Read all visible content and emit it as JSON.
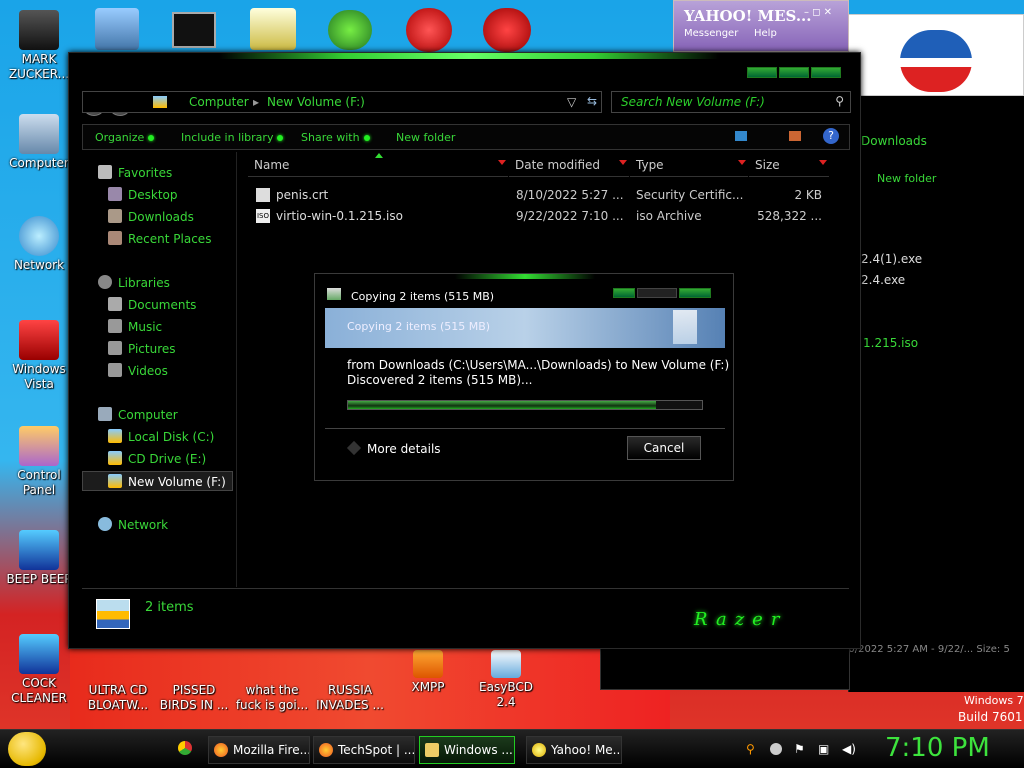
{
  "desktop_icons": [
    {
      "label": "MARK ZUCKER...",
      "icon": "person-icon"
    },
    {
      "label": "Computer",
      "icon": "computer-icon"
    },
    {
      "label": "Network",
      "icon": "network-icon"
    },
    {
      "label": "Windows Vista",
      "icon": "recycle-bin-icon"
    },
    {
      "label": "Control Panel",
      "icon": "control-panel-icon"
    },
    {
      "label": "BEEP BEEP",
      "icon": "file-icon"
    },
    {
      "label": "COCK CLEANER",
      "icon": "file-icon"
    },
    {
      "label": "ULTRA CD BLOATW...",
      "icon": "cd-icon"
    },
    {
      "label": "PISSED BIRDS IN ...",
      "icon": "bird-icon"
    },
    {
      "label": "what the fuck is goi...",
      "icon": "pig-icon"
    },
    {
      "label": "RUSSIA INVADES ...",
      "icon": "file-icon"
    },
    {
      "label": "XMPP",
      "icon": "xmpp-icon"
    },
    {
      "label": "EasyBCD 2.4",
      "icon": "easybcd-icon"
    }
  ],
  "yahoo": {
    "title": "YAHOO! MES...",
    "menu1": "Messenger",
    "menu2": "Help"
  },
  "explorer": {
    "breadcrumb": [
      "Computer",
      "New Volume (F:)"
    ],
    "search_placeholder": "Search New Volume (F:)",
    "toolbar": [
      "Organize",
      "Include in library",
      "Share with",
      "New folder"
    ],
    "nav": {
      "favorites": "Favorites",
      "favorites_items": [
        "Desktop",
        "Downloads",
        "Recent Places"
      ],
      "libraries": "Libraries",
      "libraries_items": [
        "Documents",
        "Music",
        "Pictures",
        "Videos"
      ],
      "computer": "Computer",
      "computer_items": [
        "Local Disk (C:)",
        "CD Drive (E:)",
        "New Volume (F:)"
      ],
      "network": "Network"
    },
    "columns": [
      "Name",
      "Date modified",
      "Type",
      "Size"
    ],
    "files": [
      {
        "name": "penis.crt",
        "date": "8/10/2022 5:27 ...",
        "type": "Security Certific...",
        "size": "2 KB"
      },
      {
        "name": "virtio-win-0.1.215.iso",
        "date": "9/22/2022 7:10 ...",
        "type": "iso Archive",
        "size": "528,322 ..."
      }
    ],
    "status": "2 items",
    "brand": "Razer"
  },
  "copy_dialog": {
    "title": "Copying 2 items (515 MB)",
    "header": "Copying 2 items (515 MB)",
    "from_line": "from Downloads (C:\\Users\\MA...\\Downloads) to New Volume (F:)",
    "discovered": "Discovered 2 items (515 MB)...",
    "progress": 0.87,
    "more_details": "More details",
    "cancel": "Cancel"
  },
  "bg_window": {
    "path_tail": "Downloads",
    "new_folder": "New folder",
    "items": [
      "2.4(1).exe",
      "2.4.exe",
      "1.215.iso"
    ],
    "status": "2 items selected  Date modified: 8/10/2022 5:27 AM - 9/22/...  Size: 5"
  },
  "watermark": {
    "line1": "Windows 7",
    "line2": "Build 7601"
  },
  "taskbar": {
    "tasks": [
      "Mozilla Fire...",
      "TechSpot | ...",
      "Windows ...",
      "Yahoo! Me..."
    ],
    "clock": "7:10 PM"
  },
  "colors": {
    "accent_green": "#39d839",
    "window_bg": "#000000",
    "desktop_blue": "#1aa4e8"
  }
}
